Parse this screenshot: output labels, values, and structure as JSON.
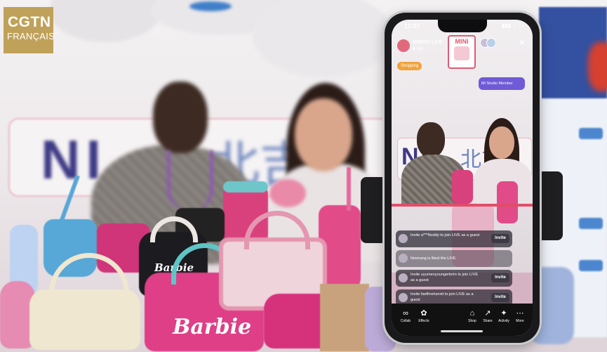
{
  "watermark": {
    "line1": "CGTN",
    "line2": "FRANÇAIS"
  },
  "background_sign": {
    "latin": "NI",
    "cjk": "北吉"
  },
  "products": {
    "brand_script": "Barbie"
  },
  "phone": {
    "status_time": "11:07",
    "host_name": "MINISO LIVE",
    "host_likes": "♥ 151",
    "shopping_label": "Shopping",
    "mini_badge": "MINI",
    "live_pill": "Mi Studio Member",
    "in_video_sign": {
      "latin": "NI",
      "cjk": "北吉"
    },
    "comments": [
      {
        "text": "Invite a***Noddy to join LIVE as a guest",
        "button": "Invite"
      },
      {
        "text": "Nnonang is liked the LIVE",
        "button": ""
      },
      {
        "text": "Invite uyumenyoungerbrim to join LIVE as a guest",
        "button": "Invite"
      },
      {
        "text": "Invite faefhrehsnxtt to join LIVE as a guest",
        "button": "Invite"
      }
    ],
    "bottom_bar": [
      {
        "icon": "collab-icon",
        "glyph": "∞",
        "label": "Collab"
      },
      {
        "icon": "effects-icon",
        "glyph": "✿",
        "label": "Effects"
      },
      {
        "icon": "shop-icon",
        "glyph": "⌂",
        "label": "Shop"
      },
      {
        "icon": "share-icon",
        "glyph": "↗",
        "label": "Share"
      },
      {
        "icon": "activity-icon",
        "glyph": "✦",
        "label": "Activity"
      },
      {
        "icon": "more-icon",
        "glyph": "⋯",
        "label": "More"
      }
    ]
  }
}
